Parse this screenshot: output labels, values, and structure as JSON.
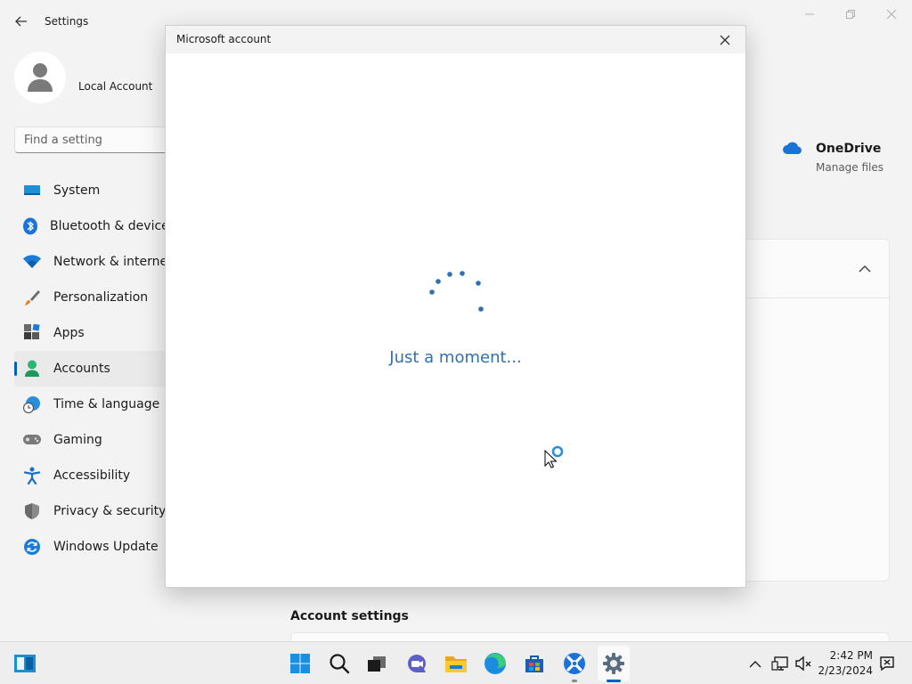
{
  "settings": {
    "app_title": "Settings",
    "account_name": "Local Account",
    "search_placeholder": "Find a setting",
    "nav_items": [
      {
        "label": "System",
        "icon": "monitor-icon"
      },
      {
        "label": "Bluetooth & devices",
        "icon": "bluetooth-icon"
      },
      {
        "label": "Network & internet",
        "icon": "wifi-icon"
      },
      {
        "label": "Personalization",
        "icon": "brush-icon"
      },
      {
        "label": "Apps",
        "icon": "apps-icon"
      },
      {
        "label": "Accounts",
        "icon": "person-icon",
        "active": true
      },
      {
        "label": "Time & language",
        "icon": "globe-clock-icon"
      },
      {
        "label": "Gaming",
        "icon": "gamepad-icon"
      },
      {
        "label": "Accessibility",
        "icon": "accessibility-icon"
      },
      {
        "label": "Privacy & security",
        "icon": "shield-icon"
      },
      {
        "label": "Windows Update",
        "icon": "update-icon"
      }
    ],
    "onedrive": {
      "title": "OneDrive",
      "subtitle": "Manage files"
    },
    "account_settings_heading": "Account settings"
  },
  "dialog": {
    "title": "Microsoft account",
    "loading_text": "Just a moment..."
  },
  "taskbar": {
    "time": "2:42 PM",
    "date": "2/23/2024",
    "pinned": [
      "start-icon",
      "search-icon",
      "task-view-icon",
      "chat-icon",
      "file-explorer-icon",
      "edge-icon",
      "store-icon",
      "app-icon",
      "settings-icon"
    ]
  },
  "colors": {
    "accent": "#005fb8",
    "loading_text": "#2f70b4",
    "background": "#f3f3f3"
  }
}
